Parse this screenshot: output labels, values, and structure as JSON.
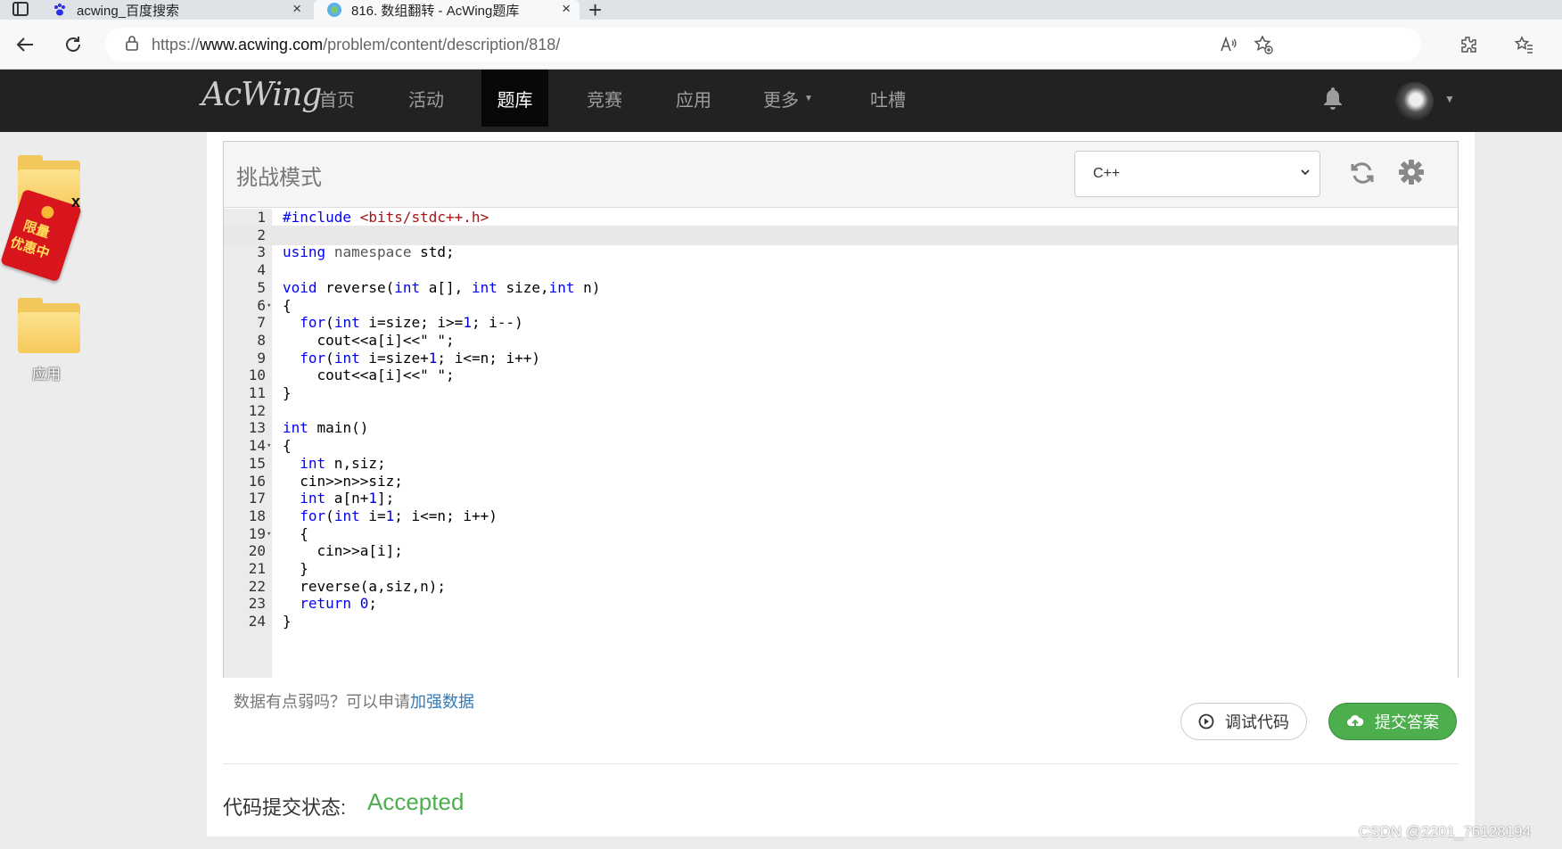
{
  "browser": {
    "tabs": [
      {
        "title": "acwing_百度搜索",
        "close": "×"
      },
      {
        "title": "816. 数组翻转 - AcWing题库",
        "close": "×"
      }
    ],
    "new_tab": "+",
    "url_host_prefix": "https://",
    "url_host": "www.acwing.com",
    "url_path": "/problem/content/description/818/"
  },
  "site": {
    "logo": "AcWing",
    "nav": [
      "首页",
      "活动",
      "题库",
      "竞赛",
      "应用",
      "更多",
      "吐槽"
    ],
    "active_nav": "题库"
  },
  "desktop": {
    "red_packet_line1": "限量",
    "red_packet_line2": "优惠中",
    "red_packet_close": "x",
    "folder2_label": "应用"
  },
  "editor": {
    "mode_title": "挑战模式",
    "language": "C++",
    "current_line": 2,
    "lines": [
      {
        "n": "1",
        "fold": ""
      },
      {
        "n": "2",
        "fold": ""
      },
      {
        "n": "3",
        "fold": ""
      },
      {
        "n": "4",
        "fold": ""
      },
      {
        "n": "5",
        "fold": ""
      },
      {
        "n": "6",
        "fold": "▾"
      },
      {
        "n": "7",
        "fold": ""
      },
      {
        "n": "8",
        "fold": ""
      },
      {
        "n": "9",
        "fold": ""
      },
      {
        "n": "10",
        "fold": ""
      },
      {
        "n": "11",
        "fold": ""
      },
      {
        "n": "12",
        "fold": ""
      },
      {
        "n": "13",
        "fold": ""
      },
      {
        "n": "14",
        "fold": "▾"
      },
      {
        "n": "15",
        "fold": ""
      },
      {
        "n": "16",
        "fold": ""
      },
      {
        "n": "17",
        "fold": ""
      },
      {
        "n": "18",
        "fold": ""
      },
      {
        "n": "19",
        "fold": "▾"
      },
      {
        "n": "20",
        "fold": ""
      },
      {
        "n": "21",
        "fold": ""
      },
      {
        "n": "22",
        "fold": ""
      },
      {
        "n": "23",
        "fold": ""
      },
      {
        "n": "24",
        "fold": ""
      }
    ],
    "code": [
      [
        {
          "t": "#include ",
          "c": "kw"
        },
        {
          "t": "<bits/stdc++.h>",
          "c": "inc"
        }
      ],
      [],
      [
        {
          "t": "using",
          "c": "kw"
        },
        {
          "t": " "
        },
        {
          "t": "namespace",
          "c": "ns"
        },
        {
          "t": " std;"
        }
      ],
      [],
      [
        {
          "t": "void",
          "c": "kw"
        },
        {
          "t": " reverse("
        },
        {
          "t": "int",
          "c": "kw"
        },
        {
          "t": " a[], "
        },
        {
          "t": "int",
          "c": "kw"
        },
        {
          "t": " size,"
        },
        {
          "t": "int",
          "c": "kw"
        },
        {
          "t": " n)"
        }
      ],
      [
        {
          "t": "{"
        }
      ],
      [
        {
          "t": "  "
        },
        {
          "t": "for",
          "c": "kw"
        },
        {
          "t": "("
        },
        {
          "t": "int",
          "c": "kw"
        },
        {
          "t": " i=size; i>="
        },
        {
          "t": "1",
          "c": "num"
        },
        {
          "t": "; i--)"
        }
      ],
      [
        {
          "t": "    cout<<a[i]<<\" \";"
        }
      ],
      [
        {
          "t": "  "
        },
        {
          "t": "for",
          "c": "kw"
        },
        {
          "t": "("
        },
        {
          "t": "int",
          "c": "kw"
        },
        {
          "t": " i=size+"
        },
        {
          "t": "1",
          "c": "num"
        },
        {
          "t": "; i<=n; i++)"
        }
      ],
      [
        {
          "t": "    cout<<a[i]<<\" \";"
        }
      ],
      [
        {
          "t": "}"
        }
      ],
      [],
      [
        {
          "t": "int",
          "c": "kw"
        },
        {
          "t": " main()"
        }
      ],
      [
        {
          "t": "{"
        }
      ],
      [
        {
          "t": "  "
        },
        {
          "t": "int",
          "c": "kw"
        },
        {
          "t": " n,siz;"
        }
      ],
      [
        {
          "t": "  cin>>n>>siz;"
        }
      ],
      [
        {
          "t": "  "
        },
        {
          "t": "int",
          "c": "kw"
        },
        {
          "t": " a[n+"
        },
        {
          "t": "1",
          "c": "num"
        },
        {
          "t": "];"
        }
      ],
      [
        {
          "t": "  "
        },
        {
          "t": "for",
          "c": "kw"
        },
        {
          "t": "("
        },
        {
          "t": "int",
          "c": "kw"
        },
        {
          "t": " i="
        },
        {
          "t": "1",
          "c": "num"
        },
        {
          "t": "; i<=n; i++)"
        }
      ],
      [
        {
          "t": "  {"
        }
      ],
      [
        {
          "t": "    cin>>a[i];"
        }
      ],
      [
        {
          "t": "  }"
        }
      ],
      [
        {
          "t": "  reverse(a,siz,n);"
        }
      ],
      [
        {
          "t": "  "
        },
        {
          "t": "return",
          "c": "kw"
        },
        {
          "t": " "
        },
        {
          "t": "0",
          "c": "num"
        },
        {
          "t": ";"
        }
      ],
      [
        {
          "t": "}"
        }
      ]
    ]
  },
  "actions": {
    "weak_data_text": "数据有点弱吗？可以申请",
    "weak_data_link": "加强数据",
    "debug_label": "调试代码",
    "submit_label": "提交答案"
  },
  "status": {
    "label": "代码提交状态:",
    "value": "Accepted"
  },
  "watermark": "CSDN @2201_76128194",
  "colors": {
    "nav_bg": "#222222",
    "accepted": "#4cae4c",
    "submit_bg": "#4cae4c",
    "link": "#337ab7"
  }
}
